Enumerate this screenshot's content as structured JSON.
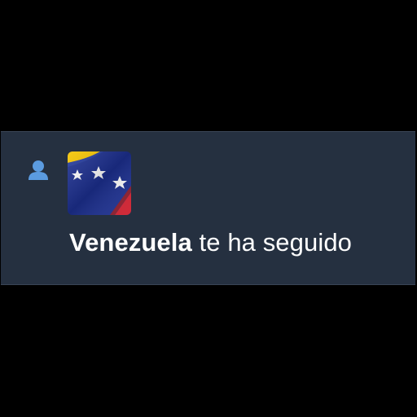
{
  "notification": {
    "type_icon": "person-follow-icon",
    "avatar": {
      "icon": "venezuela-flag-avatar",
      "colors": {
        "yellow": "#f5c400",
        "blue": "#1c2f8f",
        "red": "#cf1f2e",
        "stars": "#ffffff"
      }
    },
    "user_name": "Venezuela",
    "action_text": "te ha seguido"
  },
  "colors": {
    "background": "#000000",
    "card": "#253040",
    "icon_accent": "#5b9be0",
    "text": "#ffffff"
  }
}
